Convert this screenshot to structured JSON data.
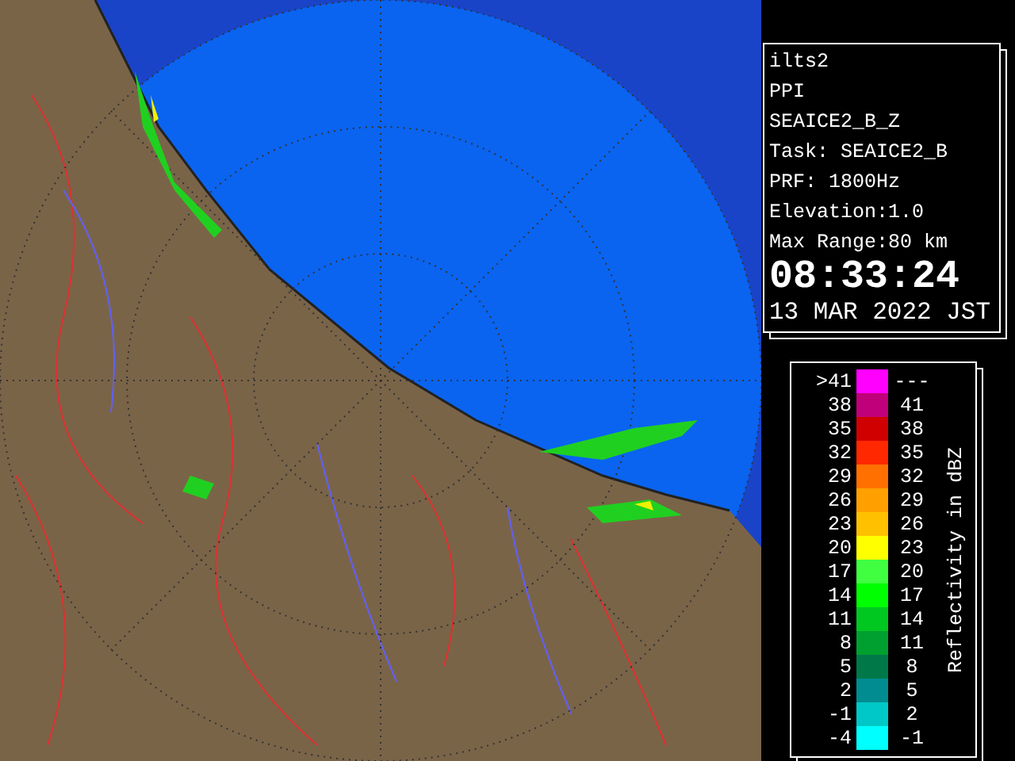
{
  "info": {
    "lines": [
      "ilts2",
      "PPI",
      "SEAICE2_B_Z",
      "Task: SEAICE2_B",
      "PRF: 1800Hz",
      "Elevation:1.0",
      "Max Range:80 km"
    ],
    "time": "08:33:24",
    "date": "13 MAR 2022 JST"
  },
  "legend": {
    "axis_label": "Reflectivity in dBZ",
    "rows": [
      {
        "low": ">41",
        "high": "---",
        "color": "#ff00ff"
      },
      {
        "low": "38",
        "high": "41",
        "color": "#c0007a"
      },
      {
        "low": "35",
        "high": "38",
        "color": "#d00000"
      },
      {
        "low": "32",
        "high": "35",
        "color": "#ff2800"
      },
      {
        "low": "29",
        "high": "32",
        "color": "#ff7000"
      },
      {
        "low": "26",
        "high": "29",
        "color": "#ffa000"
      },
      {
        "low": "23",
        "high": "26",
        "color": "#ffc000"
      },
      {
        "low": "20",
        "high": "23",
        "color": "#ffff00"
      },
      {
        "low": "17",
        "high": "20",
        "color": "#40ff40"
      },
      {
        "low": "14",
        "high": "17",
        "color": "#00ff00"
      },
      {
        "low": "11",
        "high": "14",
        "color": "#00c820"
      },
      {
        "low": "8",
        "high": "11",
        "color": "#00a030"
      },
      {
        "low": "5",
        "high": "8",
        "color": "#007848"
      },
      {
        "low": "2",
        "high": "5",
        "color": "#008c90"
      },
      {
        "low": "-1",
        "high": "2",
        "color": "#00c8c8"
      },
      {
        "low": "-4",
        "high": "-1",
        "color": "#00ffff"
      }
    ]
  }
}
